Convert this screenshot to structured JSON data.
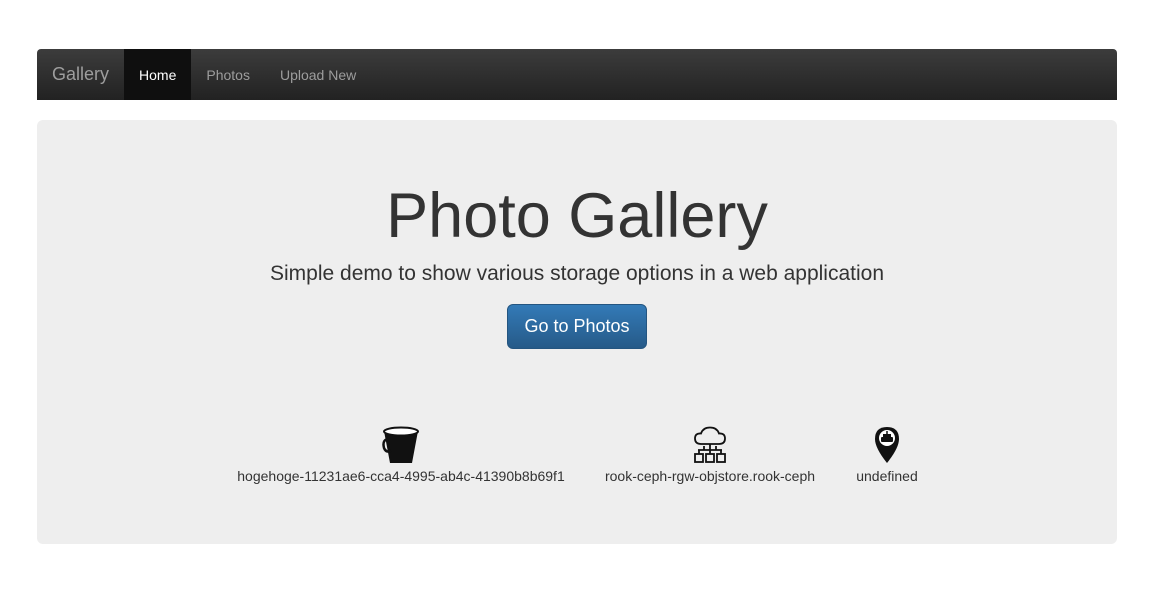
{
  "navbar": {
    "brand": "Gallery",
    "items": [
      {
        "label": "Home",
        "active": true
      },
      {
        "label": "Photos",
        "active": false
      },
      {
        "label": "Upload New",
        "active": false
      }
    ]
  },
  "hero": {
    "title": "Photo Gallery",
    "subtitle": "Simple demo to show various storage options in a web application",
    "button_label": "Go to Photos"
  },
  "storage_info": [
    {
      "icon": "bucket-icon",
      "value": "hogehoge-11231ae6-cca4-4995-ab4c-41390b8b69f1"
    },
    {
      "icon": "cloud-network-icon",
      "value": "rook-ceph-rgw-objstore.rook-ceph"
    },
    {
      "icon": "location-pin-icon",
      "value": "undefined"
    }
  ],
  "colors": {
    "navbar": "#222222",
    "hero_background": "#eeeeee",
    "primary_button": "#337ab7"
  }
}
